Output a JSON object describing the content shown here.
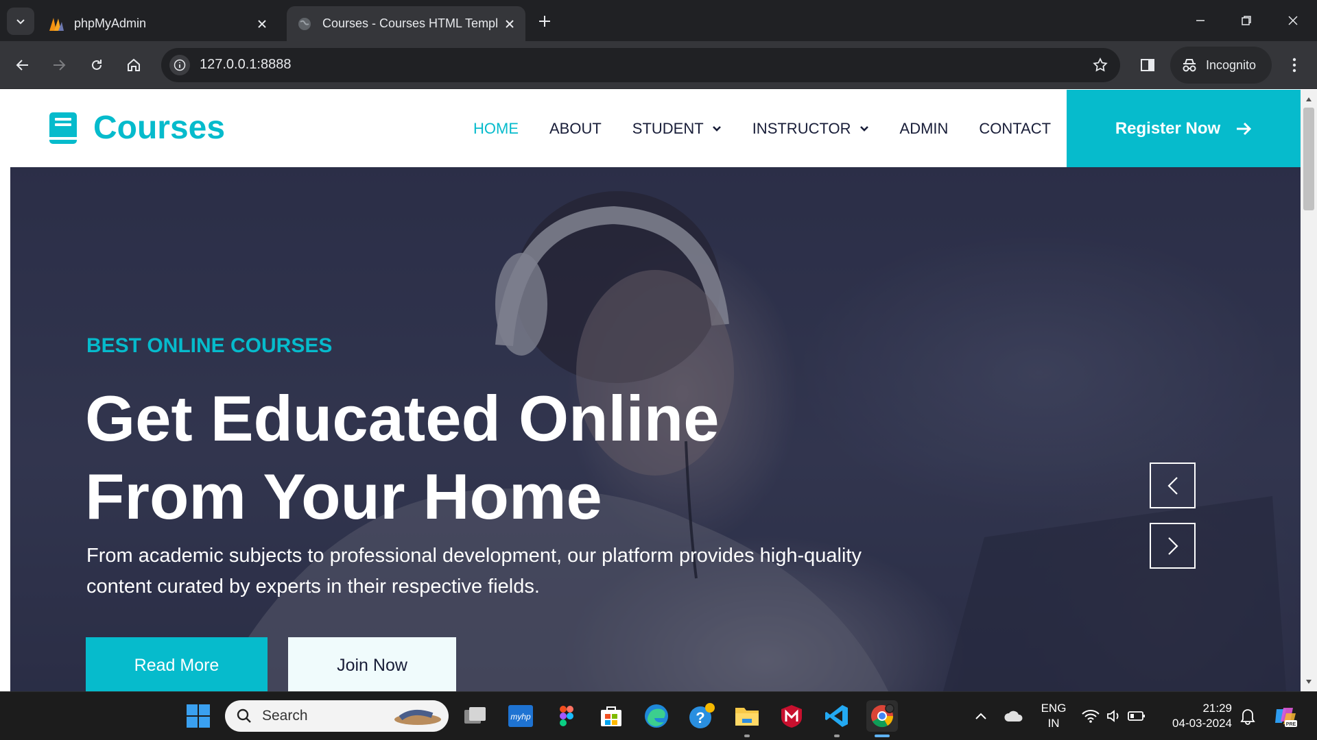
{
  "browser": {
    "tabs": [
      {
        "title": "phpMyAdmin",
        "active": false
      },
      {
        "title": "Courses - Courses HTML Templ",
        "active": true
      }
    ],
    "url": "127.0.0.1:8888",
    "incognito_label": "Incognito"
  },
  "site": {
    "logo_text": "Courses",
    "nav": [
      {
        "label": "HOME",
        "active": true
      },
      {
        "label": "ABOUT"
      },
      {
        "label": "STUDENT",
        "dropdown": true
      },
      {
        "label": "INSTRUCTOR",
        "dropdown": true
      },
      {
        "label": "ADMIN"
      },
      {
        "label": "CONTACT"
      }
    ],
    "register_label": "Register Now",
    "accent_color": "#06bbcc",
    "dark_color": "#181d38"
  },
  "hero": {
    "subtitle": "BEST ONLINE COURSES",
    "title_line1": "Get Educated Online",
    "title_line2": "From Your Home",
    "description": "From academic subjects to professional development, our platform provides high-quality content curated by experts in their respective fields.",
    "read_more_label": "Read More",
    "join_now_label": "Join Now"
  },
  "taskbar": {
    "search_placeholder": "Search",
    "lang_line1": "ENG",
    "lang_line2": "IN",
    "time": "21:29",
    "date": "04-03-2024"
  }
}
